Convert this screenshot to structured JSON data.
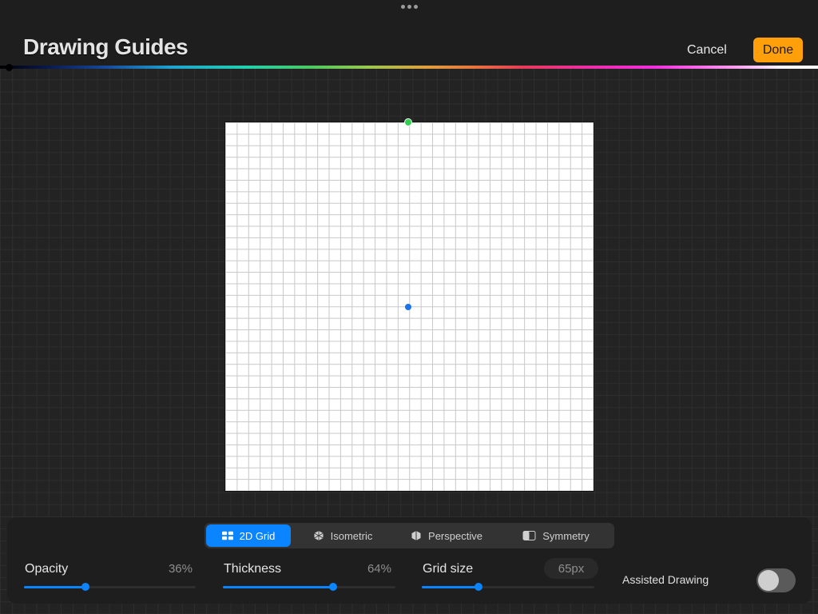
{
  "header": {
    "title": "Drawing Guides",
    "cancel_label": "Cancel",
    "done_label": "Done",
    "accent_color": "#ff9f0a"
  },
  "guide_tabs": [
    {
      "label": "2D Grid",
      "icon": "grid-icon",
      "active": true
    },
    {
      "label": "Isometric",
      "icon": "isometric-cube-icon",
      "active": false
    },
    {
      "label": "Perspective",
      "icon": "perspective-icon",
      "active": false
    },
    {
      "label": "Symmetry",
      "icon": "symmetry-icon",
      "active": false
    }
  ],
  "controls": {
    "opacity": {
      "label": "Opacity",
      "value_text": "36%",
      "value": 0.36
    },
    "thickness": {
      "label": "Thickness",
      "value_text": "64%",
      "value": 0.64
    },
    "grid_size": {
      "label": "Grid size",
      "value_text": "65px",
      "value": 0.33
    },
    "assisted_drawing": {
      "label": "Assisted Drawing",
      "enabled": false
    }
  },
  "slider_color": "#0a84ff"
}
